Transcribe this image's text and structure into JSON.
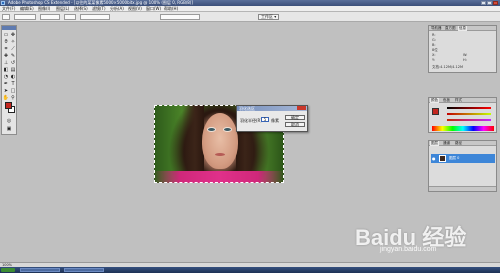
{
  "window": {
    "title": "Adobe Photoshop CS Extended - [以往的某某像素5000×5000bitx.jpg @ 100% (图层 0, RGB/8)]",
    "title_short": "Adobe Photoshop CS Extended"
  },
  "menubar": {
    "items": [
      "文件(F)",
      "编辑(E)",
      "图像(I)",
      "图层(L)",
      "选择(S)",
      "滤镜(T)",
      "分析(A)",
      "视图(V)",
      "窗口(W)",
      "帮助(H)"
    ]
  },
  "options": {
    "workspace_label": "工作区 ▾"
  },
  "dialog": {
    "title": "羽化选区",
    "label": "羽化半径(R):",
    "value": "5",
    "unit": "像素",
    "ok_label": "确定",
    "cancel_label": "取消"
  },
  "panels": {
    "navigator_tabs": [
      "导航器",
      "直方图",
      "信息"
    ],
    "navigator_rows": [
      "R:",
      "G:",
      "B:",
      "8位",
      "X:",
      "Y:",
      "W:",
      "H:",
      "文档:4.12M/4.12M"
    ],
    "color_tabs": [
      "颜色",
      "色板",
      "样式"
    ],
    "layers_tabs": [
      "图层",
      "通道",
      "路径"
    ],
    "layer_name": "图层 0"
  },
  "status": {
    "zoom": "100%"
  },
  "watermark": {
    "logo": "Baidu 经验",
    "url": "jingyan.baidu.com"
  },
  "colors": {
    "foreground": "#c3261f",
    "background": "#ffffff",
    "selected_layer": "#3d86d8"
  },
  "icons": [
    "photoshop-icon",
    "minimize-icon",
    "maximize-icon",
    "close-icon",
    "eye-icon",
    "marquee-tool-icon",
    "move-tool-icon",
    "lasso-tool-icon",
    "wand-tool-icon"
  ]
}
